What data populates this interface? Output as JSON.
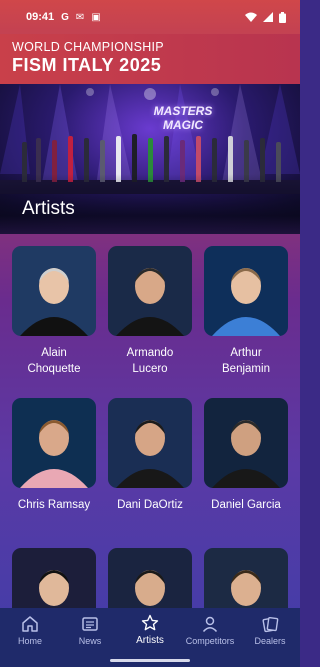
{
  "status_bar": {
    "time": "09:41",
    "left_icons": [
      "google-g-icon",
      "mail-icon",
      "lock-app-icon"
    ],
    "right_icons": [
      "wifi-icon",
      "signal-icon",
      "battery-icon"
    ]
  },
  "header": {
    "line1": "WORLD CHAMPIONSHIP",
    "line2": "FISM ITALY 2025"
  },
  "hero": {
    "logo_text_line1": "MASTERS",
    "logo_text_line2": "MAGIC",
    "title": "Artists"
  },
  "artists": [
    {
      "name_line1": "Alain",
      "name_line2": "Choquette",
      "bg": "#1f3a63",
      "skin": "#e8c4a8",
      "hair": "#cfcfcf",
      "shirt": "#111111"
    },
    {
      "name_line1": "Armando",
      "name_line2": "Lucero",
      "bg": "#1a2a48",
      "skin": "#d8a888",
      "hair": "#2a2a2a",
      "shirt": "#141414"
    },
    {
      "name_line1": "Arthur",
      "name_line2": "Benjamin",
      "bg": "#0e2f5a",
      "skin": "#e6c0a2",
      "hair": "#8a6a4a",
      "shirt": "#3c7fd6"
    },
    {
      "name_line1": "Chris Ramsay",
      "name_line2": "",
      "bg": "#0e2f52",
      "skin": "#d9a88a",
      "hair": "#8a5a30",
      "shirt": "#e9a8b4"
    },
    {
      "name_line1": "Dani DaOrtiz",
      "name_line2": "",
      "bg": "#1a2e54",
      "skin": "#d6a586",
      "hair": "#1c1c1c",
      "shirt": "#181818"
    },
    {
      "name_line1": "Daniel Garcia",
      "name_line2": "",
      "bg": "#12243e",
      "skin": "#cfa080",
      "hair": "#2a2a2a",
      "shirt": "#181818"
    },
    {
      "name_line1": "",
      "name_line2": "",
      "bg": "#1c1e3a",
      "skin": "#e0b89a",
      "hair": "#111111",
      "shirt": "#b23a2a"
    },
    {
      "name_line1": "",
      "name_line2": "",
      "bg": "#1a2440",
      "skin": "#d8ac8c",
      "hair": "#1a1a1a",
      "shirt": "#222222"
    },
    {
      "name_line1": "",
      "name_line2": "",
      "bg": "#1c2a44",
      "skin": "#dcb090",
      "hair": "#3a2a1a",
      "shirt": "#222222"
    }
  ],
  "bottom_nav": {
    "items": [
      {
        "label": "Home",
        "icon": "home-icon",
        "active": false
      },
      {
        "label": "News",
        "icon": "news-icon",
        "active": false
      },
      {
        "label": "Artists",
        "icon": "star-icon",
        "active": true
      },
      {
        "label": "Competitors",
        "icon": "person-icon",
        "active": false
      },
      {
        "label": "Dealers",
        "icon": "cards-icon",
        "active": false
      }
    ]
  },
  "colors": {
    "header_red": "#c9404a",
    "nav_bg": "#1f2a6a",
    "nav_inactive": "#b9c0e8"
  }
}
